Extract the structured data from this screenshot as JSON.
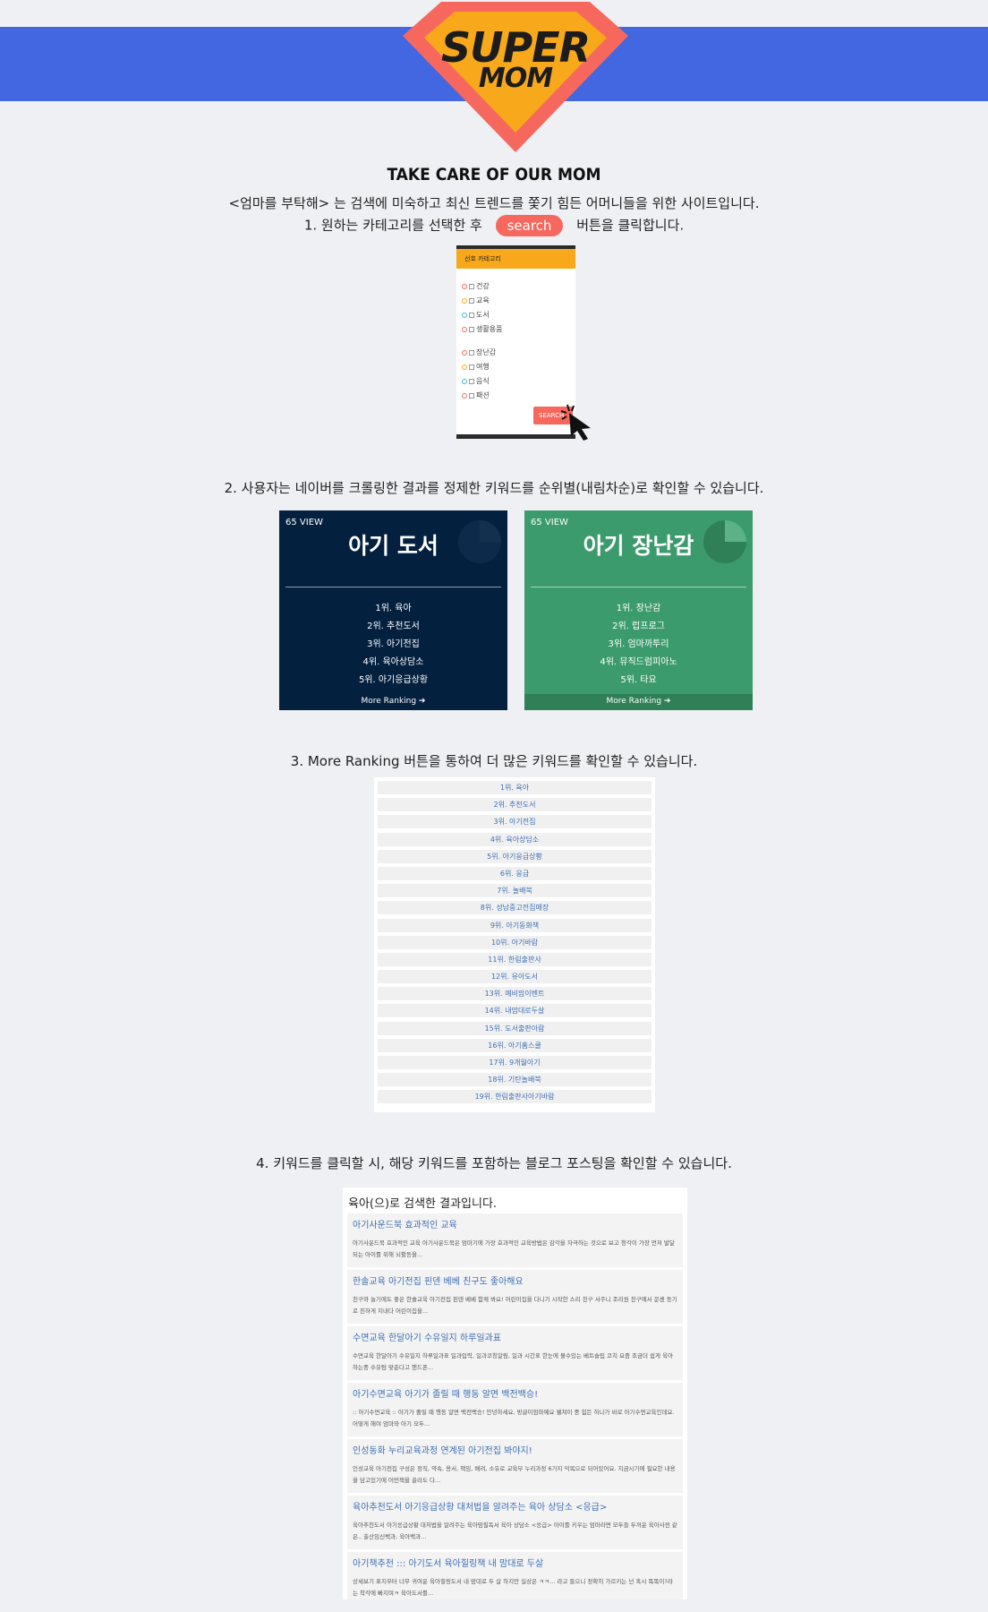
{
  "logo": {
    "line1": "SUPER",
    "line2": "MOM"
  },
  "intro": {
    "title": "TAKE CARE OF OUR MOM",
    "line1": "<엄마를 부탁해> 는 검색에 미숙하고 최신 트렌드를 쫓기 힘든 어머니들을 위한 사이트입니다.",
    "step1_prefix": "1. 원하는 카테고리를 선택한 후",
    "step1_button": "search",
    "step1_suffix": "버튼을 클릭합니다."
  },
  "category_box": {
    "header": "선호 카테고리",
    "items": [
      "건강",
      "교육",
      "도서",
      "생활용품",
      "장난감",
      "여행",
      "음식",
      "패션"
    ],
    "search_label": "SEARCH"
  },
  "steps": {
    "step2": "2. 사용자는 네이버를 크롤링한 결과를 정제한 키워드를 순위별(내림차순)로 확인할 수 있습니다.",
    "step3": "3. More Ranking 버튼을 통하여 더 많은 키워드를 확인할 수 있습니다.",
    "step4": "4. 키워드를 클릭할 시, 해당 키워드를 포함하는 블로그 포스팅을 확인할 수 있습니다."
  },
  "cards": [
    {
      "views": "65 VIEW",
      "title": "아기 도서",
      "ranks": [
        "1위. 육아",
        "2위. 추천도서",
        "3위. 아기전집",
        "4위. 육아상담소",
        "5위. 아기응급상황"
      ],
      "more": "More Ranking ➔"
    },
    {
      "views": "65 VIEW",
      "title": "아기 장난감",
      "ranks": [
        "1위. 장난감",
        "2위. 럽프로그",
        "3위. 엄마까투리",
        "4위. 뮤직드럼피아노",
        "5위. 타요"
      ],
      "more": "More Ranking ➔"
    }
  ],
  "ranking_list": [
    "1위. 육아",
    "2위. 추천도서",
    "3위. 아기전집",
    "4위. 육아상담소",
    "5위. 아기응급상황",
    "6위. 응급",
    "7위. 놀배북",
    "8위. 성남중고전집매장",
    "9위. 아기동화책",
    "10위. 아기바람",
    "11위. 한림출판사",
    "12위. 유아도서",
    "13위. 예비맘이벤트",
    "14위. 내맘대로두살",
    "15위. 도서출판아람",
    "16위. 아기홈스쿨",
    "17위. 9개월아기",
    "18위. 기탄놀배북",
    "19위. 한림출판사아기바람"
  ],
  "results": {
    "header": "육아(으)로 검색한 결과입니다.",
    "items": [
      {
        "title": "아기사운드북 효과적인 교육",
        "body": "아기사운드북 효과적인 교육 아기사운드북은 엄마기에 가장 효과적인 교육방법은 감각을 자극하는 것으로 보고 청각이 가장 먼저 발달되는 아이를 위해 뇌활동을..."
      },
      {
        "title": "한솔교육 아기전집 핀덴 베베 친구도 좋아해요",
        "body": "친구와 놀기에도 좋은 한솔교육 아기전집 핀덴 베베 함께 봐요! 어린이집을 다니기 시작한 스리 친구 서주니 조리원 친구에서 문센 동기로 친하게 지내다 어린이집을..."
      },
      {
        "title": "수면교육 한달아기 수유일지 하루일과표",
        "body": "수면교육 한달아기 수유일지 하루일과표 일과입력, 일과코칭알림, 일과 시간표 한눈에 볼수있는 베트슬립 코치 요즘 조금더 쉽게 육아하는중 수유텀 맞춘다고 핸드폰..."
      },
      {
        "title": "아기수면교육 아기가 졸릴 때 행동 알면 백전백승!",
        "body": ":: 아기수면교육 :: 아기가 졸릴 때 행동 알면 백전백승! 안녕하세요, 방글이엄마예요 웰쳐이 중 힘든 하나가 바로 아기수면교육인데요. 어떻게 해야 엄마와 아기 모두..."
      },
      {
        "title": "인성동화 누리교육과정 연계된 아기전집 봐야지!",
        "body": "인성교육 아기전집 구성은 정직, 약속, 용서, 책임, 배려, 소유로 교육부 누리과정 6가지 덕목으로 되어있어요. 지금시기에 필요한 내용을 담고있기에 어떤책을 골라도 다..."
      },
      {
        "title": "육아추천도서 아기응급상황 대처법을 알려주는 육아 상담소 <응급>",
        "body": "육아추천도서 아기응급상황 대처법을 알려주는 육아맘필독서 육아 상담소 <응급> 아이를 키우는 엄마라면 모두들 두꺼운 육아사전 같은.. 출산임신백과, 육아백과..."
      },
      {
        "title": "아기책추천 ::: 아기도서 육아힐링책 내 맘대로 두살",
        "body": "상세보기 표지부터 너무 귀여운 육아힐링도서 내 맘대로 두 살 하지만 실상은 ㅋㅋ... 라고 들으니 정확히 가르키는 넌 혹시 똑똑이?라는 착각에 빠지며ㅋ 육아도서를..."
      }
    ]
  },
  "colors": {
    "banner": "#4267e0",
    "accent": "#f6685e",
    "card_navy": "#03203f",
    "card_green": "#3b9b6c",
    "logo_orange": "#f7a81b",
    "link": "#3d6fb5"
  }
}
